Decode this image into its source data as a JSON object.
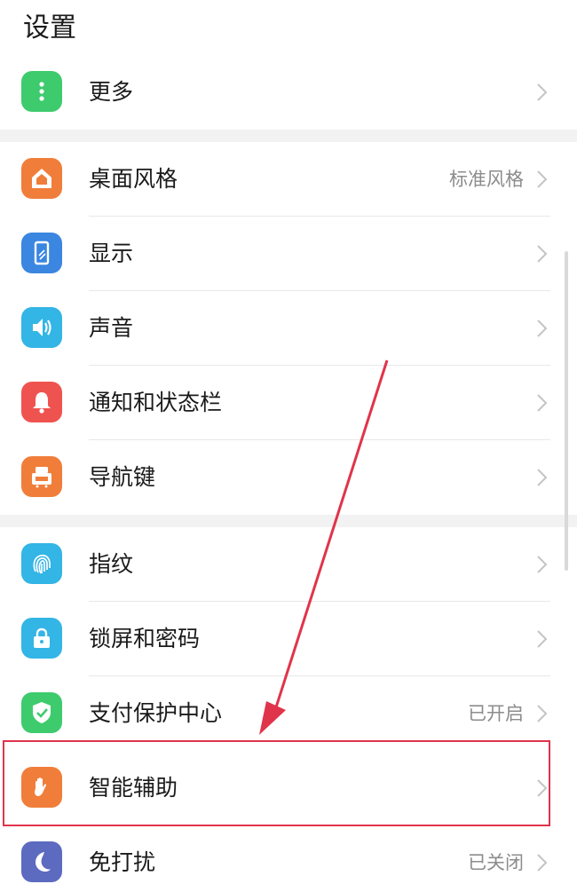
{
  "header": {
    "title": "设置"
  },
  "colors": {
    "accent_highlight": "#e0344b",
    "more_icon": "#3ecb6e",
    "desktop_icon": "#f07e3a",
    "display_icon": "#3a86e0",
    "sound_icon": "#33b5e5",
    "notify_icon": "#ef5350",
    "navkey_icon": "#f07e3a",
    "fingerprint_icon": "#33b5e5",
    "lock_icon": "#33b5e5",
    "payment_icon": "#3ecb6e",
    "assist_icon": "#f07e3a",
    "dnd_icon": "#5c6bc0"
  },
  "items": [
    {
      "label": "更多",
      "value": "",
      "icon": "more-icon"
    },
    {
      "label": "桌面风格",
      "value": "标准风格",
      "icon": "home-icon"
    },
    {
      "label": "显示",
      "value": "",
      "icon": "display-icon"
    },
    {
      "label": "声音",
      "value": "",
      "icon": "speaker-icon"
    },
    {
      "label": "通知和状态栏",
      "value": "",
      "icon": "bell-icon"
    },
    {
      "label": "导航键",
      "value": "",
      "icon": "navigation-key-icon"
    },
    {
      "label": "指纹",
      "value": "",
      "icon": "fingerprint-icon"
    },
    {
      "label": "锁屏和密码",
      "value": "",
      "icon": "lock-icon"
    },
    {
      "label": "支付保护中心",
      "value": "已开启",
      "icon": "shield-check-icon"
    },
    {
      "label": "智能辅助",
      "value": "",
      "icon": "hand-icon"
    },
    {
      "label": "免打扰",
      "value": "已关闭",
      "icon": "moon-icon"
    }
  ]
}
